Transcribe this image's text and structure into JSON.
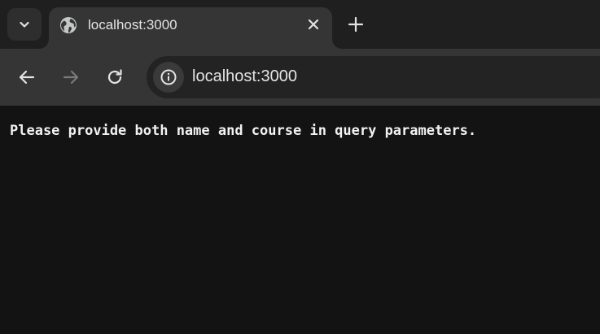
{
  "browser": {
    "tab": {
      "title": "localhost:3000",
      "favicon": "globe-icon"
    },
    "address_bar": {
      "url": "localhost:3000",
      "site_info_icon": "info-icon"
    },
    "icons": {
      "tab_search": "chevron-down-icon",
      "close_tab": "close-icon",
      "new_tab": "plus-icon",
      "back": "back-arrow-icon",
      "forward": "forward-arrow-icon",
      "reload": "reload-icon"
    },
    "colors": {
      "tabstrip_bg": "#1f1f1f",
      "toolbar_bg": "#353535",
      "omnibox_bg": "#232323",
      "page_bg": "#131313",
      "text": "#e3e3e3",
      "disabled_icon": "#7a7a7a"
    }
  },
  "page": {
    "message": "Please provide both name and course in query parameters."
  }
}
